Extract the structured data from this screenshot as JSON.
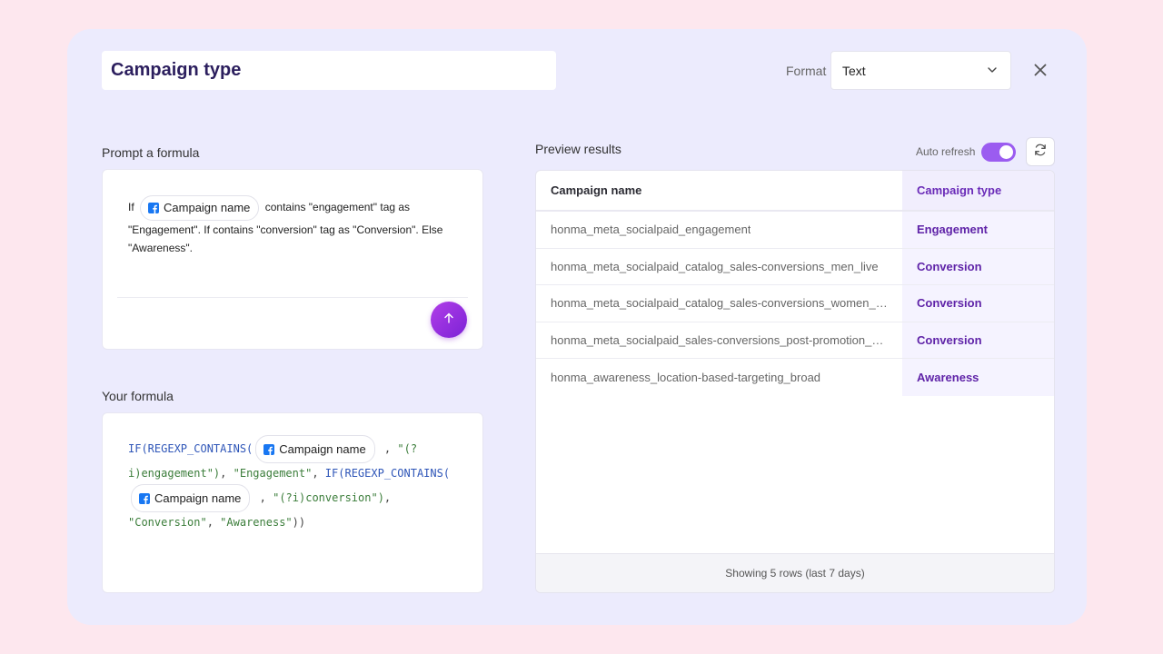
{
  "header": {
    "column_title": "Campaign type",
    "format_label": "Format",
    "format_value": "Text"
  },
  "prompt": {
    "section_label": "Prompt a formula",
    "text_before": "If",
    "chip_label": "Campaign name",
    "text_after_line1": "contains \"engagement\" tag as",
    "text_rest": "\"Engagement\". If contains \"conversion\" tag as \"Conversion\". Else \"Awareness\"."
  },
  "formula": {
    "section_label": "Your formula",
    "tok_if1": "IF(REGEXP_CONTAINS(",
    "chip1": "Campaign name",
    "tok_comma1": ",",
    "tok_str1": "\"(?i)engagement\")",
    "tok_comma2": ",",
    "tok_str2": "\"Engagement\"",
    "tok_comma3": ",",
    "tok_if2": "IF(REGEXP_CONTAINS(",
    "chip2": "Campaign name",
    "tok_comma4": ",",
    "tok_str3": "\"(?i)conversion\")",
    "tok_comma5": ",",
    "tok_str4": "\"Conversion\"",
    "tok_comma6": ",",
    "tok_str5": "\"Awareness\"",
    "tok_close": "))"
  },
  "preview": {
    "section_label": "Preview results",
    "auto_refresh_label": "Auto refresh",
    "auto_refresh_on": true,
    "columns": [
      "Campaign name",
      "Campaign type"
    ],
    "rows": [
      {
        "name": "honma_meta_socialpaid_engagement",
        "type": "Engagement"
      },
      {
        "name": "honma_meta_socialpaid_catalog_sales-conversions_men_live",
        "type": "Conversion"
      },
      {
        "name": "honma_meta_socialpaid_catalog_sales-conversions_women_…",
        "type": "Conversion"
      },
      {
        "name": "honma_meta_socialpaid_sales-conversions_post-promotion_…",
        "type": "Conversion"
      },
      {
        "name": "honma_awareness_location-based-targeting_broad",
        "type": "Awareness"
      }
    ],
    "footer": "Showing 5 rows (last 7 days)"
  },
  "icons": {
    "close": "close-icon",
    "chevron": "chevron-down-icon",
    "send": "arrow-up-icon",
    "refresh": "refresh-icon",
    "facebook": "facebook-icon"
  },
  "colors": {
    "background": "#fde7ee",
    "panel": "#ecebfd",
    "accent": "#9b5cf0",
    "type_text": "#5f23a8"
  }
}
